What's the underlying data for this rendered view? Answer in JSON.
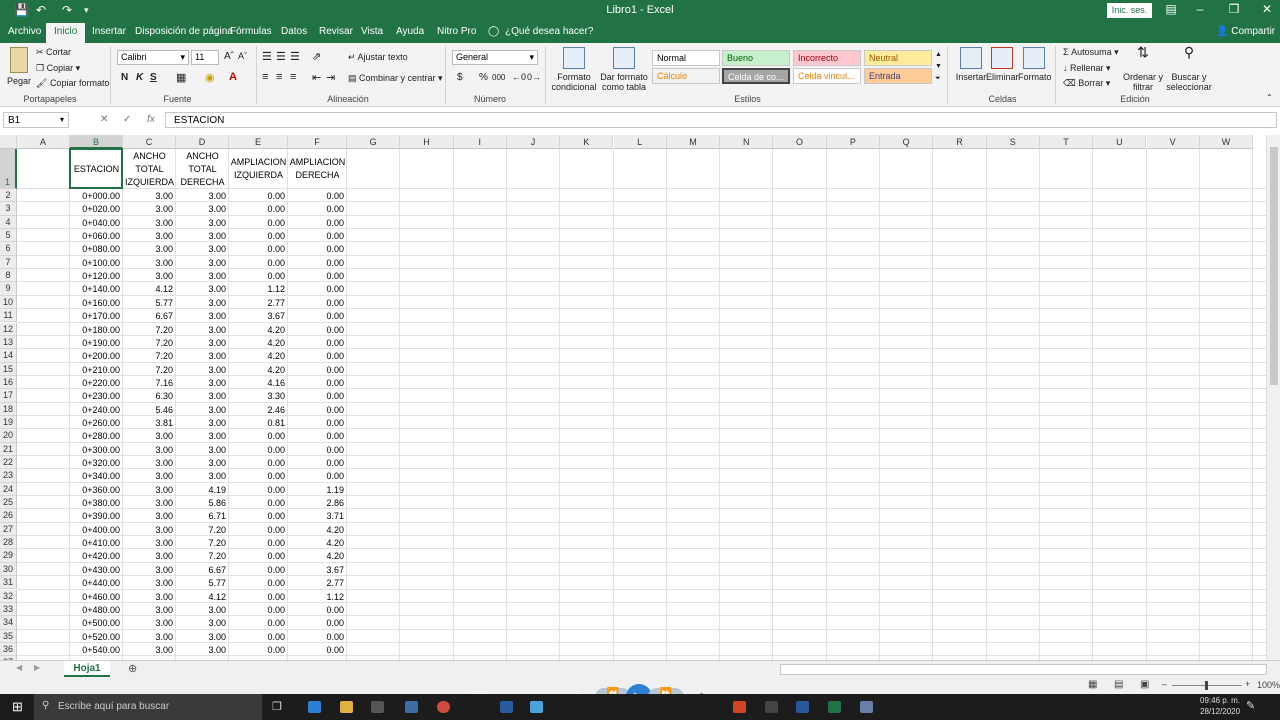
{
  "window": {
    "title": "Libro1 - Excel",
    "signin": "Inic. ses.",
    "share": "Compartir"
  },
  "menu": {
    "tabs": [
      "Archivo",
      "Inicio",
      "Insertar",
      "Disposición de página",
      "Fórmulas",
      "Datos",
      "Revisar",
      "Vista",
      "Ayuda",
      "Nitro Pro",
      "¿Qué desea hacer?"
    ],
    "active": "Inicio"
  },
  "ribbon": {
    "clipboard": {
      "label": "Portapapeles",
      "paste": "Pegar",
      "cut": "Cortar",
      "copy": "Copiar",
      "format_painter": "Copiar formato"
    },
    "font": {
      "label": "Fuente",
      "name": "Calibri",
      "size": "11",
      "bold": "N",
      "italic": "K",
      "underline": "S"
    },
    "alignment": {
      "label": "Alineación",
      "wrap": "Ajustar texto",
      "merge": "Combinar y centrar"
    },
    "number": {
      "label": "Número",
      "format": "General",
      "currency": "$",
      "percent": "%",
      "thousands": "000"
    },
    "styles": {
      "label": "Estilos",
      "cond_format": "Formato condicional",
      "table_format": "Dar formato como tabla",
      "cells": [
        {
          "text": "Normal",
          "bg": "#ffffff",
          "fg": "#000000"
        },
        {
          "text": "Bueno",
          "bg": "#c6efce",
          "fg": "#006100"
        },
        {
          "text": "Incorrecto",
          "bg": "#ffc7ce",
          "fg": "#9c0006"
        },
        {
          "text": "Neutral",
          "bg": "#ffeb9c",
          "fg": "#9c5700"
        },
        {
          "text": "Cálculo",
          "bg": "#f2f2f2",
          "fg": "#fa7d00"
        },
        {
          "text": "Celda de co...",
          "bg": "#a5a5a5",
          "fg": "#ffffff"
        },
        {
          "text": "Celda vincul...",
          "bg": "#ffffff",
          "fg": "#fa7d00"
        },
        {
          "text": "Entrada",
          "bg": "#ffcc99",
          "fg": "#3f3f76"
        }
      ]
    },
    "cells": {
      "label": "Celdas",
      "insert": "Insertar",
      "delete": "Eliminar",
      "format": "Formato"
    },
    "editing": {
      "label": "Edición",
      "autosum": "Autosuma",
      "fill": "Rellenar",
      "clear": "Borrar",
      "sort": "Ordenar y filtrar",
      "find": "Buscar y seleccionar"
    }
  },
  "formula_bar": {
    "name_box": "B1",
    "fx": "fx",
    "content": "ESTACION"
  },
  "grid": {
    "columns": [
      "A",
      "B",
      "C",
      "D",
      "E",
      "F",
      "G",
      "H",
      "I",
      "J",
      "K",
      "L",
      "M",
      "N",
      "O",
      "P",
      "Q",
      "R",
      "S",
      "T",
      "U",
      "V",
      "W"
    ],
    "headers": [
      "ESTACION",
      "ANCHO TOTAL IZQUIERDA",
      "ANCHO TOTAL DERECHA",
      "AMPLIACION IZQUIERDA",
      "AMPLIACION DERECHA"
    ],
    "rows": [
      [
        "0+000.00",
        "3.00",
        "3.00",
        "0.00",
        "0.00"
      ],
      [
        "0+020.00",
        "3.00",
        "3.00",
        "0.00",
        "0.00"
      ],
      [
        "0+040.00",
        "3.00",
        "3.00",
        "0.00",
        "0.00"
      ],
      [
        "0+060.00",
        "3.00",
        "3.00",
        "0.00",
        "0.00"
      ],
      [
        "0+080.00",
        "3.00",
        "3.00",
        "0.00",
        "0.00"
      ],
      [
        "0+100.00",
        "3.00",
        "3.00",
        "0.00",
        "0.00"
      ],
      [
        "0+120.00",
        "3.00",
        "3.00",
        "0.00",
        "0.00"
      ],
      [
        "0+140.00",
        "4.12",
        "3.00",
        "1.12",
        "0.00"
      ],
      [
        "0+160.00",
        "5.77",
        "3.00",
        "2.77",
        "0.00"
      ],
      [
        "0+170.00",
        "6.67",
        "3.00",
        "3.67",
        "0.00"
      ],
      [
        "0+180.00",
        "7.20",
        "3.00",
        "4.20",
        "0.00"
      ],
      [
        "0+190.00",
        "7.20",
        "3.00",
        "4.20",
        "0.00"
      ],
      [
        "0+200.00",
        "7.20",
        "3.00",
        "4.20",
        "0.00"
      ],
      [
        "0+210.00",
        "7.20",
        "3.00",
        "4.20",
        "0.00"
      ],
      [
        "0+220.00",
        "7.16",
        "3.00",
        "4.16",
        "0.00"
      ],
      [
        "0+230.00",
        "6.30",
        "3.00",
        "3.30",
        "0.00"
      ],
      [
        "0+240.00",
        "5.46",
        "3.00",
        "2.46",
        "0.00"
      ],
      [
        "0+260.00",
        "3.81",
        "3.00",
        "0.81",
        "0.00"
      ],
      [
        "0+280.00",
        "3.00",
        "3.00",
        "0.00",
        "0.00"
      ],
      [
        "0+300.00",
        "3.00",
        "3.00",
        "0.00",
        "0.00"
      ],
      [
        "0+320.00",
        "3.00",
        "3.00",
        "0.00",
        "0.00"
      ],
      [
        "0+340.00",
        "3.00",
        "3.00",
        "0.00",
        "0.00"
      ],
      [
        "0+360.00",
        "3.00",
        "4.19",
        "0.00",
        "1.19"
      ],
      [
        "0+380.00",
        "3.00",
        "5.86",
        "0.00",
        "2.86"
      ],
      [
        "0+390.00",
        "3.00",
        "6.71",
        "0.00",
        "3.71"
      ],
      [
        "0+400.00",
        "3.00",
        "7.20",
        "0.00",
        "4.20"
      ],
      [
        "0+410.00",
        "3.00",
        "7.20",
        "0.00",
        "4.20"
      ],
      [
        "0+420.00",
        "3.00",
        "7.20",
        "0.00",
        "4.20"
      ],
      [
        "0+430.00",
        "3.00",
        "6.67",
        "0.00",
        "3.67"
      ],
      [
        "0+440.00",
        "3.00",
        "5.77",
        "0.00",
        "2.77"
      ],
      [
        "0+460.00",
        "3.00",
        "4.12",
        "0.00",
        "1.12"
      ],
      [
        "0+480.00",
        "3.00",
        "3.00",
        "0.00",
        "0.00"
      ],
      [
        "0+500.00",
        "3.00",
        "3.00",
        "0.00",
        "0.00"
      ],
      [
        "0+520.00",
        "3.00",
        "3.00",
        "0.00",
        "0.00"
      ],
      [
        "0+540.00",
        "3.00",
        "3.00",
        "0.00",
        "0.00"
      ]
    ]
  },
  "sheet": {
    "tab": "Hoja1",
    "add": "⊕"
  },
  "status": {
    "zoom": "100%"
  },
  "taskbar": {
    "search": "Escribe aquí para buscar",
    "video_time": "18:06",
    "clock_time": "09:46 p. m.",
    "clock_date": "28/12/2020"
  }
}
